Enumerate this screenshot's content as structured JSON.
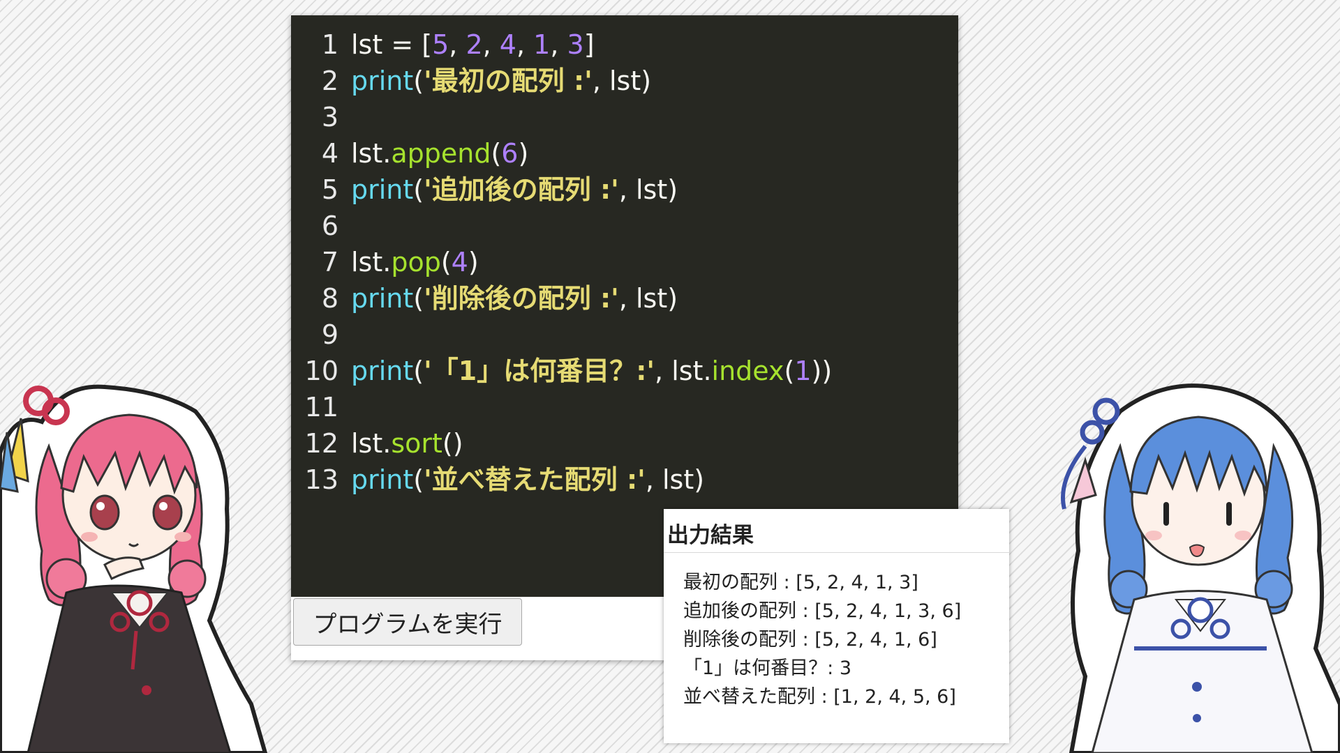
{
  "editor": {
    "lines": [
      {
        "n": "1",
        "tokens": [
          [
            "lst = [",
            "code"
          ],
          [
            "5",
            "num"
          ],
          [
            ", ",
            "code"
          ],
          [
            "2",
            "num"
          ],
          [
            ", ",
            "code"
          ],
          [
            "4",
            "num"
          ],
          [
            ", ",
            "code"
          ],
          [
            "1",
            "num"
          ],
          [
            ", ",
            "code"
          ],
          [
            "3",
            "num"
          ],
          [
            "]",
            "code"
          ]
        ]
      },
      {
        "n": "2",
        "tokens": [
          [
            "print",
            "kw"
          ],
          [
            "(",
            "code"
          ],
          [
            "'最初の配列 :'",
            "str"
          ],
          [
            ", lst)",
            "code"
          ]
        ]
      },
      {
        "n": "3",
        "tokens": []
      },
      {
        "n": "4",
        "tokens": [
          [
            "lst.",
            "code"
          ],
          [
            "append",
            "fn"
          ],
          [
            "(",
            "code"
          ],
          [
            "6",
            "num"
          ],
          [
            ")",
            "code"
          ]
        ]
      },
      {
        "n": "5",
        "tokens": [
          [
            "print",
            "kw"
          ],
          [
            "(",
            "code"
          ],
          [
            "'追加後の配列 :'",
            "str"
          ],
          [
            ", lst)",
            "code"
          ]
        ]
      },
      {
        "n": "6",
        "tokens": []
      },
      {
        "n": "7",
        "tokens": [
          [
            "lst.",
            "code"
          ],
          [
            "pop",
            "fn"
          ],
          [
            "(",
            "code"
          ],
          [
            "4",
            "num"
          ],
          [
            ")",
            "code"
          ]
        ]
      },
      {
        "n": "8",
        "tokens": [
          [
            "print",
            "kw"
          ],
          [
            "(",
            "code"
          ],
          [
            "'削除後の配列 :'",
            "str"
          ],
          [
            ", lst)",
            "code"
          ]
        ]
      },
      {
        "n": "9",
        "tokens": []
      },
      {
        "n": "10",
        "tokens": [
          [
            "print",
            "kw"
          ],
          [
            "(",
            "code"
          ],
          [
            "'「1」は何番目？:'",
            "str"
          ],
          [
            ", lst.",
            "code"
          ],
          [
            "index",
            "fn"
          ],
          [
            "(",
            "code"
          ],
          [
            "1",
            "num"
          ],
          [
            "))",
            "code"
          ]
        ]
      },
      {
        "n": "11",
        "tokens": []
      },
      {
        "n": "12",
        "tokens": [
          [
            "lst.",
            "code"
          ],
          [
            "sort",
            "fn"
          ],
          [
            "()",
            "code"
          ]
        ]
      },
      {
        "n": "13",
        "tokens": [
          [
            "print",
            "kw"
          ],
          [
            "(",
            "code"
          ],
          [
            "'並べ替えた配列 :'",
            "str"
          ],
          [
            ", lst)",
            "code"
          ]
        ]
      }
    ]
  },
  "run_button": {
    "label": "プログラムを実行"
  },
  "output": {
    "title": "出力結果",
    "lines": [
      "最初の配列 : [5, 2, 4, 1, 3]",
      "追加後の配列 : [5, 2, 4, 1, 3, 6]",
      "削除後の配列 : [5, 2, 4, 1, 6]",
      "「1」は何番目？: 3",
      "並べ替えた配列 : [1, 2, 4, 5, 6]"
    ]
  },
  "colors": {
    "editor_bg": "#272822",
    "keyword": "#66d9ef",
    "function": "#a6e22e",
    "number": "#ae81ff",
    "string": "#e6db74",
    "akane_hair": "#ec6a8e",
    "aoi_hair": "#5b8fdc"
  },
  "characters": [
    "akane-character",
    "aoi-character"
  ]
}
